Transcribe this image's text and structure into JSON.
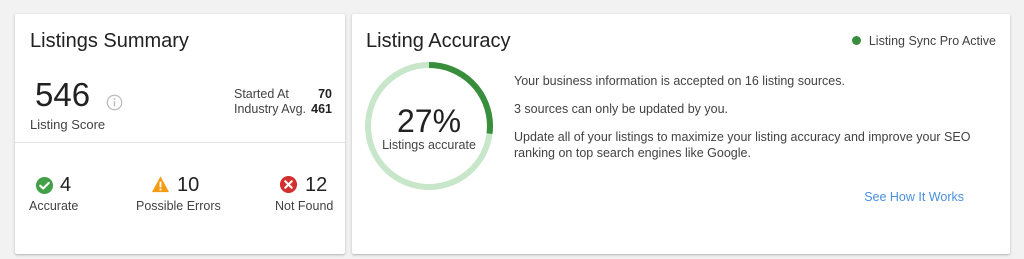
{
  "summary": {
    "title": "Listings Summary",
    "score": "546",
    "score_label": "Listing Score",
    "started_label": "Started At",
    "started_value": "70",
    "avg_label": "Industry Avg.",
    "avg_value": "461",
    "statuses": [
      {
        "count": "4",
        "label": "Accurate",
        "icon": "check-circle-icon",
        "color": "#43a047"
      },
      {
        "count": "10",
        "label": "Possible Errors",
        "icon": "warning-triangle-icon",
        "color": "#f39c12"
      },
      {
        "count": "12",
        "label": "Not Found",
        "icon": "close-circle-icon",
        "color": "#d32f2f"
      }
    ]
  },
  "accuracy": {
    "title": "Listing Accuracy",
    "sync_status": "Listing Sync Pro Active",
    "sync_color": "#388e3c",
    "percent": 27,
    "percent_text": "27%",
    "gauge_label": "Listings accurate",
    "gauge_fill_color": "#388e3c",
    "gauge_track_color": "#c8e6c9",
    "lines": [
      "Your business information is accepted on 16 listing sources.",
      "3 sources can only be updated by you.",
      "Update all of your listings to maximize your listing accuracy and improve your SEO ranking on top search engines like Google."
    ],
    "link_text": "See How It Works"
  }
}
